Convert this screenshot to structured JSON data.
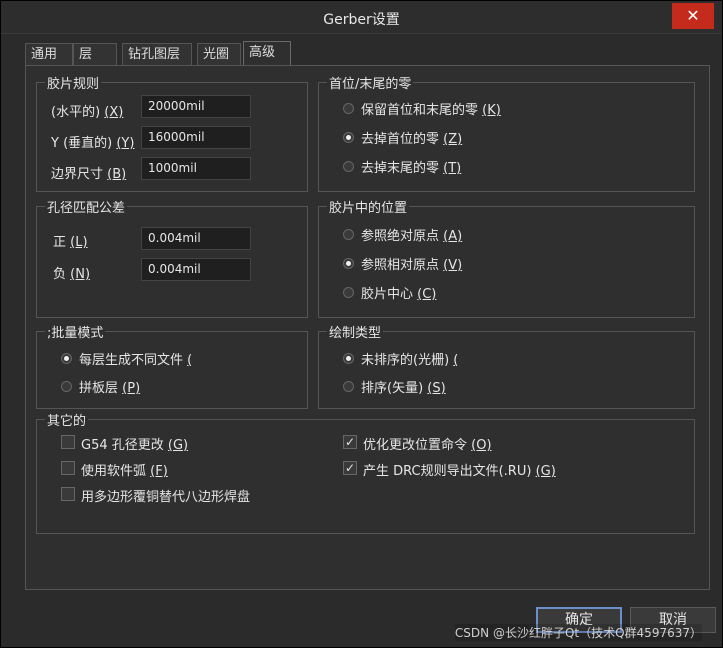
{
  "window": {
    "title": "Gerber设置",
    "close_label": "✕"
  },
  "tabs": [
    "通用",
    "层",
    "钻孔图层",
    "光圈",
    "高级"
  ],
  "film_rules": {
    "legend": "胶片规则",
    "x_label": "(水平的)",
    "x_key": "(X)",
    "x_value": "20000mil",
    "y_label": "Y (垂直的)",
    "y_key": "(Y)",
    "y_value": "16000mil",
    "border_label": "边界尺寸",
    "border_key": "(B)",
    "border_value": "1000mil"
  },
  "leading_trailing_zeros": {
    "legend": "首位/末尾的零",
    "options": [
      {
        "label": "保留首位和末尾的零",
        "key": "(K)",
        "selected": false
      },
      {
        "label": "去掉首位的零",
        "key": "(Z)",
        "selected": true
      },
      {
        "label": "去掉末尾的零",
        "key": "(T)",
        "selected": false
      }
    ]
  },
  "aperture_tolerance": {
    "legend": "孔径匹配公差",
    "plus_label": "正",
    "plus_key": "(L)",
    "plus_value": "0.004mil",
    "minus_label": "负",
    "minus_key": "(N)",
    "minus_value": "0.004mil"
  },
  "film_position": {
    "legend": "胶片中的位置",
    "options": [
      {
        "label": "参照绝对原点",
        "key": "(A)",
        "selected": false
      },
      {
        "label": "参照相对原点",
        "key": "(V)",
        "selected": true
      },
      {
        "label": "胶片中心",
        "key": "(C)",
        "selected": false
      }
    ]
  },
  "batch_mode": {
    "legend": ";批量模式",
    "options": [
      {
        "label": "每层生成不同文件",
        "key": "(",
        "selected": true
      },
      {
        "label": "拼板层",
        "key": "(P)",
        "selected": false
      }
    ]
  },
  "plot_type": {
    "legend": "绘制类型",
    "options": [
      {
        "label": "未排序的(光栅)",
        "key": "(",
        "selected": true
      },
      {
        "label": "排序(矢量)",
        "key": "(S)",
        "selected": false
      }
    ]
  },
  "other": {
    "legend": "其它的",
    "left": [
      {
        "label": "G54 孔径更改",
        "key": "(G)",
        "checked": false
      },
      {
        "label": "使用软件弧",
        "key": "(F)",
        "checked": false
      },
      {
        "label": "用多边形覆铜替代八边形焊盘",
        "key": "",
        "checked": false
      }
    ],
    "right": [
      {
        "label": "优化更改位置命令",
        "key": "(O)",
        "checked": true
      },
      {
        "label": "产生 DRC规则导出文件(.RU)",
        "key": "(G)",
        "checked": true
      }
    ]
  },
  "buttons": {
    "ok": "确定",
    "cancel": "取消"
  },
  "watermark": "CSDN @长沙红胖子Qt（技术Q群4597637）",
  "check_glyph": "✓"
}
